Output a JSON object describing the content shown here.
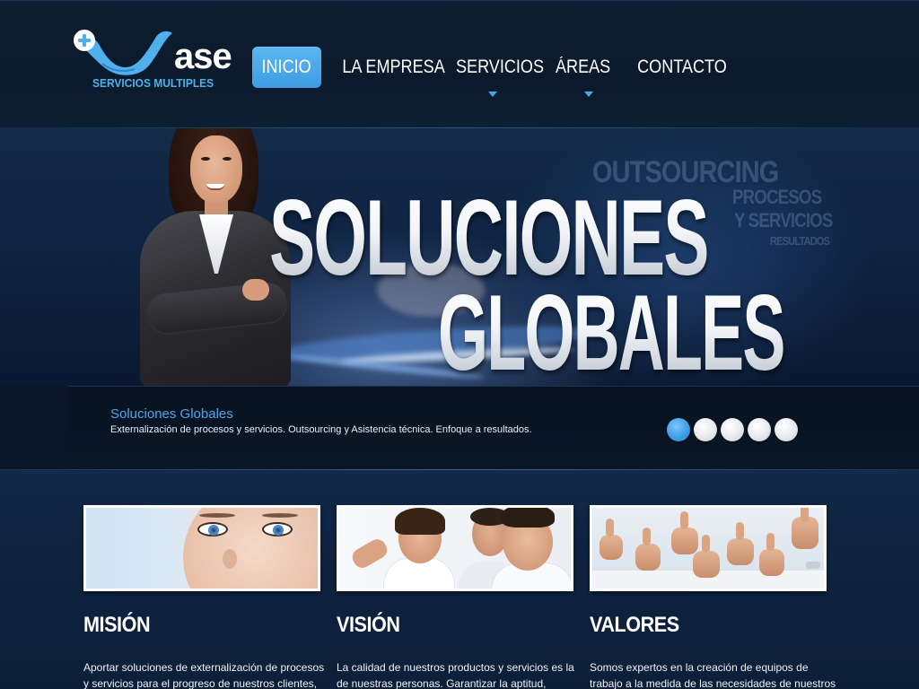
{
  "colors": {
    "header_bg": "#0c1a2c",
    "accent": "#4aa8ec",
    "logo_blue": "#4fb0ec",
    "text": "#ffffff"
  },
  "header": {
    "logo": {
      "wordmark": "ase",
      "tagline": "SERVICIOS MULTIPLES",
      "icon": "plus-circle-icon"
    },
    "nav": [
      {
        "label": "INICIO",
        "active": true,
        "has_dropdown": false
      },
      {
        "label": "LA EMPRESA",
        "active": false,
        "has_dropdown": false
      },
      {
        "label": "SERVICIOS",
        "active": false,
        "has_dropdown": true
      },
      {
        "label": "ÁREAS",
        "active": false,
        "has_dropdown": true
      },
      {
        "label": "CONTACTO",
        "active": false,
        "has_dropdown": false
      }
    ]
  },
  "hero": {
    "headline_1": "SOLUCIONES",
    "headline_2": "GLOBALES",
    "background_words": [
      "OUTSOURCING",
      "PROCESOS",
      "Y SERVICIOS",
      "RESULTADOS"
    ]
  },
  "caption": {
    "title": "Soluciones Globales",
    "body": "Externalización de procesos y servicios. Outsourcing y Asistencia técnica. Enfoque a resultados."
  },
  "slider": {
    "dots": [
      {
        "active": true
      },
      {
        "active": false
      },
      {
        "active": false
      },
      {
        "active": false
      },
      {
        "active": false
      }
    ]
  },
  "columns": [
    {
      "heading": "MISIÓN",
      "image": "woman-face-photo",
      "lines": [
        "Aportar soluciones de externalización de procesos",
        "y servicios para el progreso de nuestros clientes,"
      ]
    },
    {
      "heading": "VISIÓN",
      "image": "team-meeting-photo",
      "lines": [
        "La calidad de nuestros productos y servicios es la",
        "de nuestras personas. Garantizar la aptitud,"
      ]
    },
    {
      "heading": "VALORES",
      "image": "thumbs-up-photo",
      "lines": [
        "Somos expertos en la creación de equipos de",
        "trabajo a la medida de las necesidades de nuestros"
      ]
    }
  ]
}
